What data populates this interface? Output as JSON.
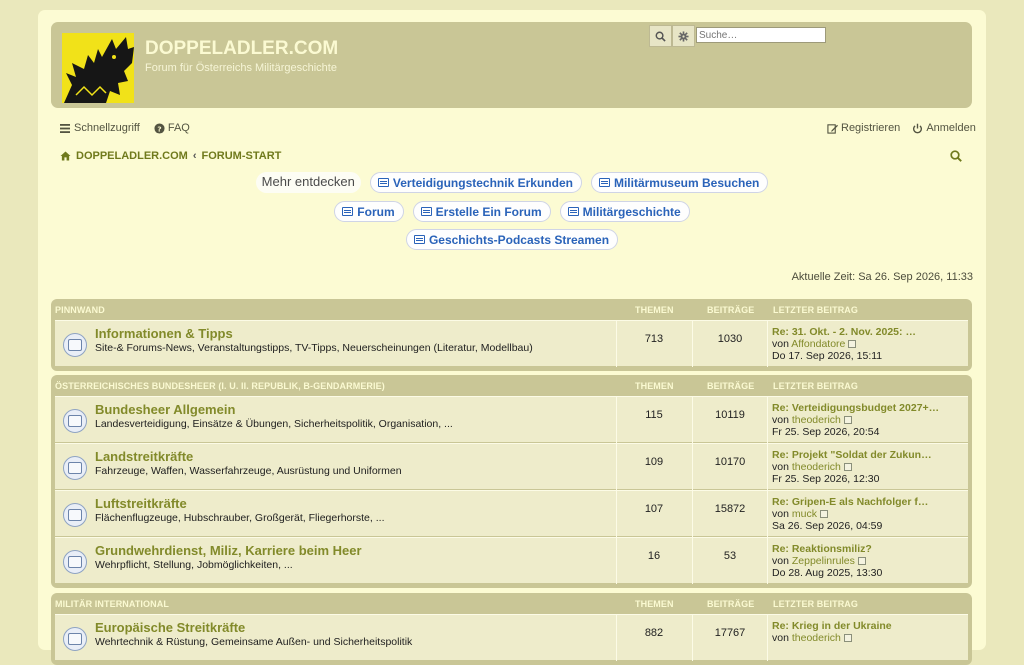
{
  "header": {
    "title": "DOPPELADLER.COM",
    "subtitle": "Forum für Österreichs Militärgeschichte",
    "search_placeholder": "Suche…"
  },
  "nav": {
    "quicklinks": "Schnellzugriff",
    "faq": "FAQ",
    "register": "Registrieren",
    "login": "Anmelden"
  },
  "breadcrumb": {
    "home": "DOPPELADLER.COM",
    "sep": "‹",
    "forum": "FORUM-START"
  },
  "explore": {
    "label": "Mehr entdecken",
    "chips": [
      "Verteidigungstechnik Erkunden",
      "Militärmuseum Besuchen",
      "Forum",
      "Erstelle Ein Forum",
      "Militärgeschichte",
      "Geschichts-Podcasts Streamen"
    ]
  },
  "current_time": "Aktuelle Zeit: Sa 26. Sep 2026, 11:33",
  "columns": {
    "topics": "THEMEN",
    "posts": "BEITRÄGE",
    "last": "LETZTER BEITRAG"
  },
  "by": "von",
  "categories": [
    {
      "name": "PINNWAND",
      "forums": [
        {
          "title": "Informationen & Tipps",
          "desc": "Site-& Forums-News, Veranstaltungstipps, TV-Tipps, Neuerscheinungen (Literatur, Modellbau)",
          "topics": "713",
          "posts": "1030",
          "last_title": "Re: 31. Okt. - 2. Nov. 2025: …",
          "last_user": "Affondatore",
          "last_date": "Do 17. Sep 2026, 15:11"
        }
      ]
    },
    {
      "name": "ÖSTERREICHISCHES BUNDESHEER (I. U. II. REPUBLIK, B-GENDARMERIE)",
      "forums": [
        {
          "title": "Bundesheer Allgemein",
          "desc": "Landesverteidigung, Einsätze & Übungen, Sicherheitspolitik, Organisation, ...",
          "topics": "115",
          "posts": "10119",
          "last_title": "Re: Verteidigungsbudget 2027+…",
          "last_user": "theoderich",
          "last_date": "Fr 25. Sep 2026, 20:54"
        },
        {
          "title": "Landstreitkräfte",
          "desc": "Fahrzeuge, Waffen, Wasserfahrzeuge, Ausrüstung und Uniformen",
          "topics": "109",
          "posts": "10170",
          "last_title": "Re: Projekt \"Soldat der Zukun…",
          "last_user": "theoderich",
          "last_date": "Fr 25. Sep 2026, 12:30"
        },
        {
          "title": "Luftstreitkräfte",
          "desc": "Flächenflugzeuge, Hubschrauber, Großgerät, Fliegerhorste, ...",
          "topics": "107",
          "posts": "15872",
          "last_title": "Re: Gripen-E als Nachfolger f…",
          "last_user": "muck",
          "last_date": "Sa 26. Sep 2026, 04:59"
        },
        {
          "title": "Grundwehrdienst, Miliz, Karriere beim Heer",
          "desc": "Wehrpflicht, Stellung, Jobmöglichkeiten, ...",
          "topics": "16",
          "posts": "53",
          "last_title": "Re: Reaktionsmiliz?",
          "last_user": "Zeppelinrules",
          "last_date": "Do 28. Aug 2025, 13:30"
        }
      ]
    },
    {
      "name": "MILITÄR INTERNATIONAL",
      "forums": [
        {
          "title": "Europäische Streitkräfte",
          "desc": "Wehrtechnik & Rüstung, Gemeinsame Außen- und Sicherheitspolitik",
          "topics": "882",
          "posts": "17767",
          "last_title": "Re: Krieg in der Ukraine",
          "last_user": "theoderich",
          "last_date": ""
        }
      ]
    }
  ]
}
